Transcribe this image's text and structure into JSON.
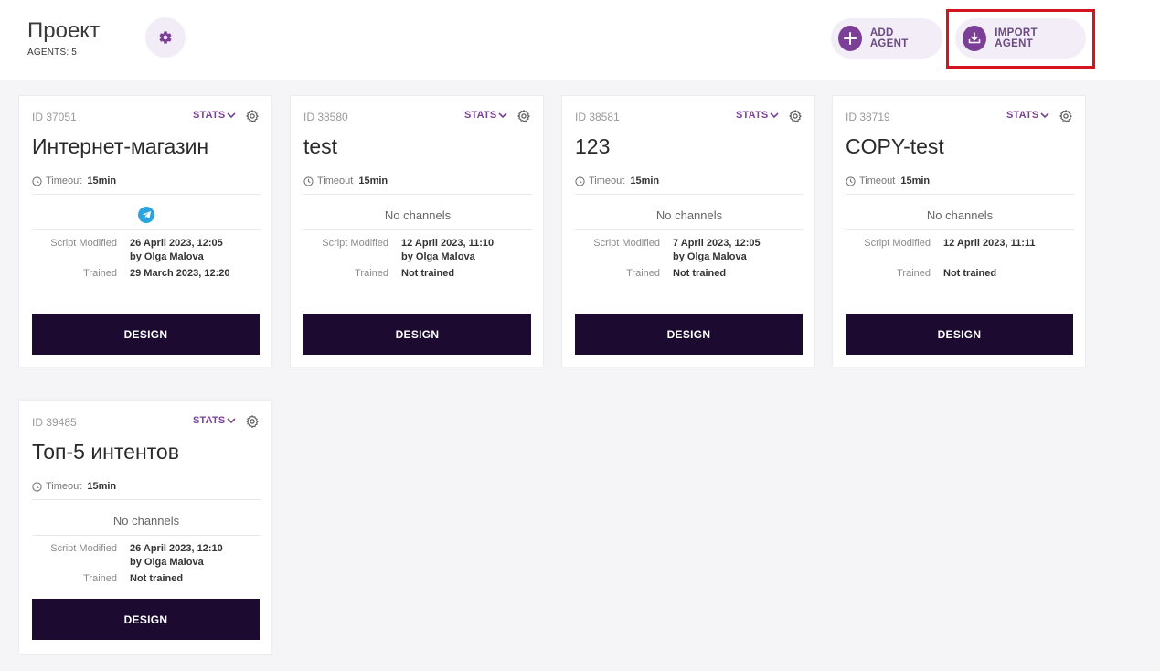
{
  "header": {
    "project_title": "Проект",
    "agents_count": "AGENTS: 5",
    "add_agent_label": "ADD AGENT",
    "import_agent_label": "IMPORT AGENT"
  },
  "colors": {
    "accent": "#7b3f98",
    "design_button": "#1c0a30",
    "highlight": "#d4151d",
    "telegram": "#2aa3de"
  },
  "labels": {
    "stats": "STATS",
    "timeout": "Timeout",
    "script_modified": "Script Modified",
    "trained": "Trained",
    "design": "DESIGN"
  },
  "agents": [
    {
      "id": "ID 37051",
      "name": "Интернет-магазин",
      "timeout": "15min",
      "channels": "",
      "channel_icon": "telegram-icon",
      "script_modified": "26 April 2023, 12:05",
      "modified_by": "by Olga Malova",
      "trained": "29 March 2023, 12:20"
    },
    {
      "id": "ID 38580",
      "name": "test",
      "timeout": "15min",
      "channels": "No channels",
      "script_modified": "12 April 2023, 11:10",
      "modified_by": "by Olga Malova",
      "trained": "Not trained"
    },
    {
      "id": "ID 38581",
      "name": "123",
      "timeout": "15min",
      "channels": "No channels",
      "script_modified": "7 April 2023, 12:05",
      "modified_by": "by Olga Malova",
      "trained": "Not trained"
    },
    {
      "id": "ID 38719",
      "name": "COPY-test",
      "timeout": "15min",
      "channels": "No channels",
      "script_modified": "12 April 2023, 11:11",
      "modified_by": "",
      "trained": "Not trained"
    },
    {
      "id": "ID 39485",
      "name": "Топ-5 интентов",
      "timeout": "15min",
      "channels": "No channels",
      "script_modified": "26 April 2023, 12:10",
      "modified_by": "by Olga Malova",
      "trained": "Not trained"
    }
  ]
}
